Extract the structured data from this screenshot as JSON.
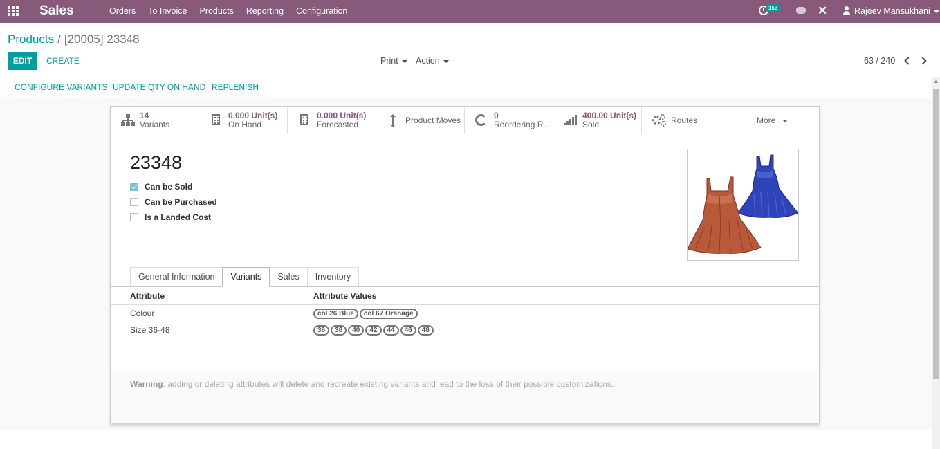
{
  "navbar": {
    "app_name": "Sales",
    "menu": [
      "Orders",
      "To Invoice",
      "Products",
      "Reporting",
      "Configuration"
    ],
    "activity_count": "153",
    "user_name": "Rajeev Mansukhani",
    "color": "#875a7b"
  },
  "breadcrumb": {
    "parent": "Products",
    "separator": "/",
    "current": "[20005] 23348"
  },
  "control_panel": {
    "edit_label": "EDIT",
    "create_label": "CREATE",
    "print_label": "Print",
    "action_label": "Action",
    "pager": "63 / 240"
  },
  "statusbar": {
    "buttons": [
      "CONFIGURE VARIANTS",
      "UPDATE QTY ON HAND",
      "REPLENISH"
    ]
  },
  "stat_buttons": [
    {
      "icon": "sitemap-icon",
      "value": "14",
      "label": "Variants"
    },
    {
      "icon": "building-icon",
      "value": "0.000 Unit(s)",
      "label": "On Hand"
    },
    {
      "icon": "building-icon",
      "value": "0.000 Unit(s)",
      "label": "Forecasted"
    },
    {
      "icon": "arrows-v-icon",
      "label": "Product Moves"
    },
    {
      "icon": "refresh-icon",
      "value": "0",
      "label": "Reordering R..."
    },
    {
      "icon": "signal-icon",
      "value": "400.00 Unit(s)",
      "label": "Sold"
    },
    {
      "icon": "gears-icon",
      "label": "Routes"
    },
    {
      "label": "More"
    }
  ],
  "product": {
    "name": "23348",
    "options": [
      {
        "label": "Can be Sold",
        "checked": true
      },
      {
        "label": "Can be Purchased",
        "checked": false
      },
      {
        "label": "Is a Landed Cost",
        "checked": false
      }
    ]
  },
  "tabs": [
    "General Information",
    "Variants",
    "Sales",
    "Inventory"
  ],
  "active_tab": "Variants",
  "attributes": {
    "headers": [
      "Attribute",
      "Attribute Values"
    ],
    "rows": [
      {
        "attribute": "Colour",
        "values": [
          "col 26 Blue",
          "col 67 Oranage"
        ]
      },
      {
        "attribute": "Size 36-48",
        "values": [
          "36",
          "38",
          "40",
          "42",
          "44",
          "46",
          "48"
        ]
      }
    ]
  },
  "warning": {
    "label": "Warning",
    "text": ": adding or deleting attributes will delete and recreate existing variants and lead to the loss of their possible customizations."
  }
}
